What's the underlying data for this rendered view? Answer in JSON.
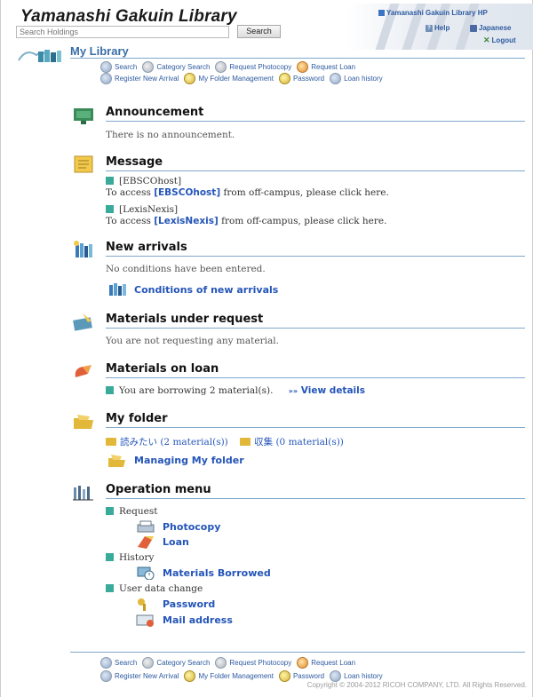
{
  "header": {
    "title": "Yamanashi Gakuin Library",
    "search_placeholder": "Search Holdings",
    "search_button": "Search",
    "hp_link": "Yamanashi Gakuin Library HP",
    "help_link": "Help",
    "japanese_link": "Japanese",
    "logout_link": "Logout"
  },
  "my_library": {
    "title": "My Library"
  },
  "nav": {
    "row1": [
      "Search",
      "Category Search",
      "Request Photocopy",
      "Request Loan"
    ],
    "row2": [
      "Register New Arrival",
      "My Folder Management",
      "Password",
      "Loan history"
    ]
  },
  "sections": {
    "announcement": {
      "title": "Announcement",
      "text": "There is no announcement."
    },
    "message": {
      "title": "Message",
      "items": [
        {
          "name": "[EBSCOhost]",
          "prefix": "To access ",
          "link": "[EBSCOhost]",
          "suffix": " from off-campus, please click here."
        },
        {
          "name": "[LexisNexis]",
          "prefix": "To access ",
          "link": "[LexisNexis]",
          "suffix": " from off-campus, please click here."
        }
      ]
    },
    "new_arrivals": {
      "title": "New arrivals",
      "text": "No conditions have been entered.",
      "link": "Conditions of new arrivals"
    },
    "materials_request": {
      "title": "Materials under request",
      "text": "You are not requesting any material."
    },
    "materials_loan": {
      "title": "Materials on loan",
      "text": "You are borrowing 2 material(s).",
      "link": "View details",
      "arrows": "»»"
    },
    "my_folder": {
      "title": "My folder",
      "folder1": "読みたい (2 material(s))",
      "folder2": "収集 (0 material(s))",
      "link": "Managing My folder"
    },
    "operation": {
      "title": "Operation menu",
      "request_label": "Request",
      "photocopy": "Photocopy",
      "loan": "Loan",
      "history_label": "History",
      "borrowed": "Materials Borrowed",
      "userdata_label": "User data change",
      "password": "Password",
      "mail": "Mail address"
    }
  },
  "footer": {
    "copyright": "Copyright © 2004-2012 RICOH COMPANY, LTD. All Rights Reserved."
  }
}
